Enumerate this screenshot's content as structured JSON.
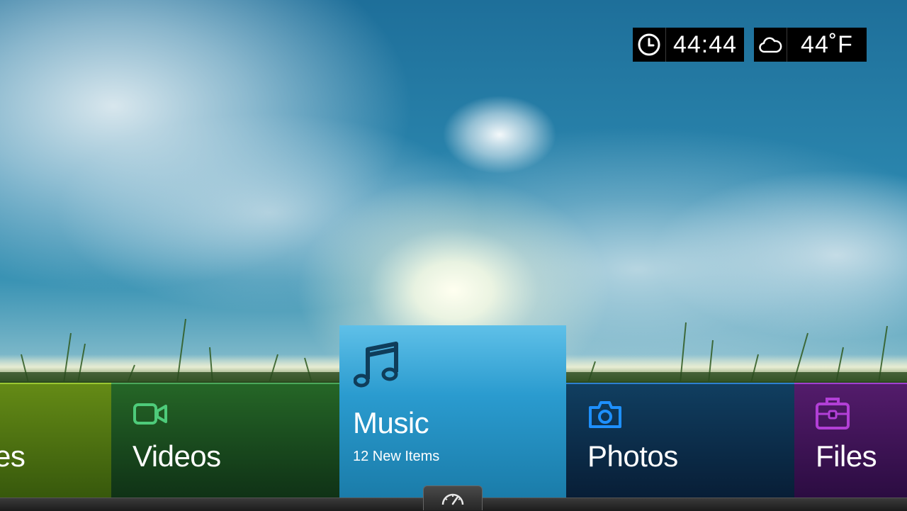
{
  "status": {
    "time": "44:44",
    "temperature": "44˚F",
    "clock_icon": "clock-icon",
    "weather_icon": "cloud-icon"
  },
  "tiles": {
    "games": {
      "label": "es",
      "accent": "#8dc21f"
    },
    "videos": {
      "label": "Videos",
      "icon": "video-camera-icon",
      "accent": "#4ecb7a"
    },
    "music": {
      "label": "Music",
      "subtitle": "12 New Items",
      "icon": "music-note-icon",
      "accent": "#2a9bcf"
    },
    "photos": {
      "label": "Photos",
      "icon": "camera-icon",
      "accent": "#1e90ff"
    },
    "files": {
      "label": "Files",
      "icon": "briefcase-icon",
      "accent": "#b23fd6"
    }
  },
  "bottom_bar": {
    "icon": "speedometer-icon"
  }
}
